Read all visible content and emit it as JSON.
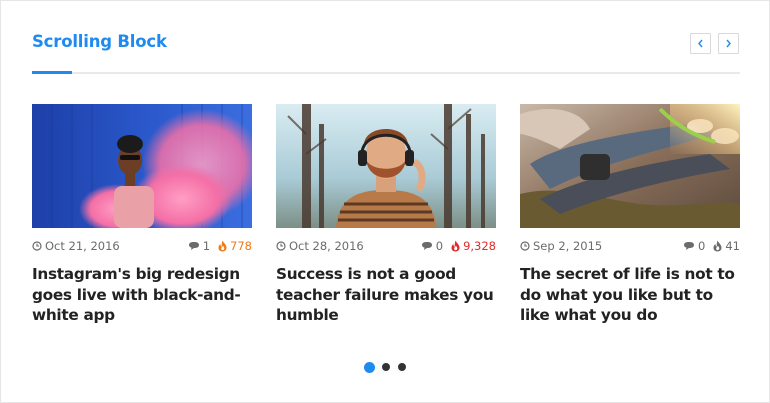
{
  "widget": {
    "title": "Scrolling Block",
    "accent_color": "#1f8bf0",
    "nav": {
      "prev_icon": "chevron-left-icon",
      "next_icon": "chevron-right-icon"
    }
  },
  "cards": [
    {
      "image": "woman-pink-smoke-photo",
      "date": "Oct 21, 2016",
      "comments": "1",
      "views": "778",
      "views_color": "#f07a16",
      "headline": "Instagram's big redesign goes live with black-and-white app"
    },
    {
      "image": "bearded-man-headphones-photo",
      "date": "Oct 28, 2016",
      "comments": "0",
      "views": "9,328",
      "views_color": "#e02b2b",
      "headline": "Success is not a good teacher failure makes you humble"
    },
    {
      "image": "people-lying-grass-photo",
      "date": "Sep 2, 2015",
      "comments": "0",
      "views": "41",
      "views_color": "#6b6b6b",
      "headline": "The secret of life is not to do what you like but to like what you do"
    }
  ],
  "pagination": {
    "pages": 3,
    "active_index": 0
  }
}
